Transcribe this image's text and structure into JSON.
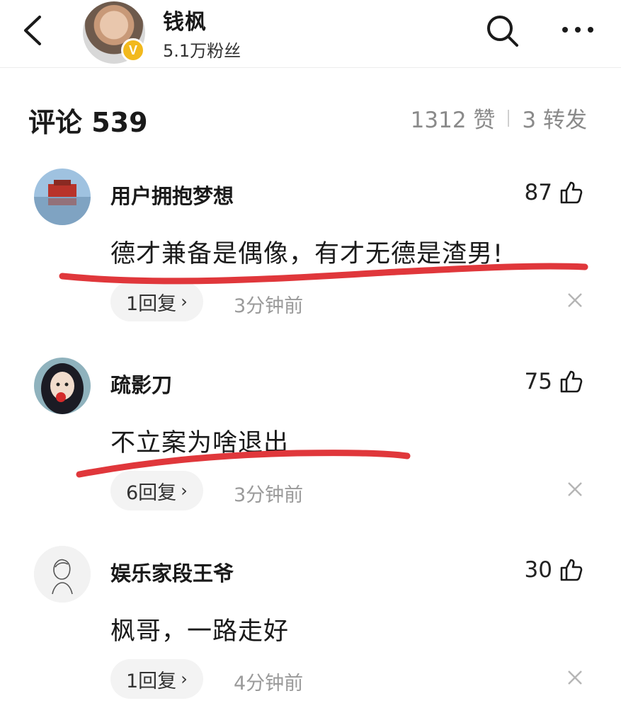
{
  "header": {
    "author_name": "钱枫",
    "author_fans": "5.1万粉丝",
    "verify_badge": "V",
    "icons": [
      "back-icon",
      "search-icon",
      "more-icon"
    ]
  },
  "summary": {
    "comments_label": "评论 539",
    "likes": "1312 赞",
    "reposts": "3 转发"
  },
  "comments": [
    {
      "user": "用户拥抱梦想",
      "likes": "87",
      "text": "德才兼备是偶像，有才无德是渣男!",
      "replies": "1回复",
      "time": "3分钟前",
      "underlined": true
    },
    {
      "user": "疏影刀",
      "likes": "75",
      "text": "不立案为啥退出",
      "replies": "6回复",
      "time": "3分钟前",
      "underlined": true
    },
    {
      "user": "娱乐家段王爷",
      "likes": "30",
      "text": "枫哥，一路走好",
      "replies": "1回复",
      "time": "4分钟前",
      "underlined": false
    }
  ],
  "colors": {
    "underline": "#e0373b",
    "badge": "#f2b91d",
    "muted": "#9a9a9a"
  }
}
